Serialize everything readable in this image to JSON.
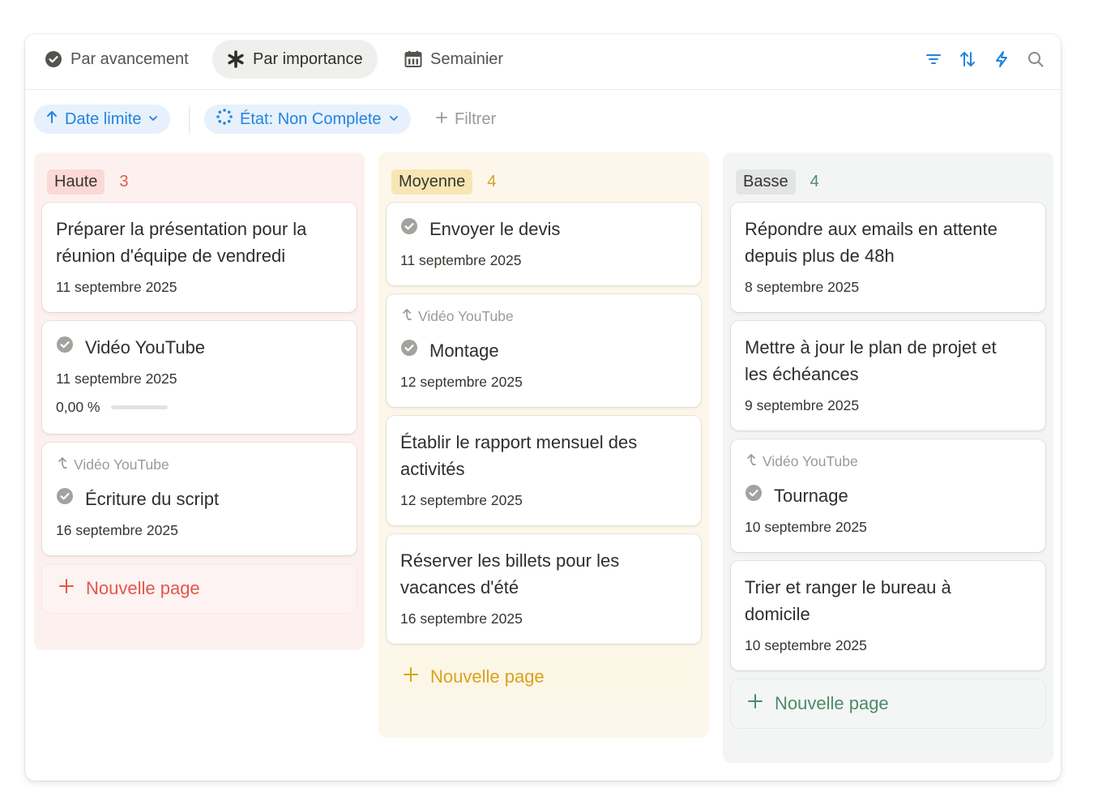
{
  "tabs": [
    {
      "label": "Par avancement",
      "icon": "check-circle-icon",
      "active": false
    },
    {
      "label": "Par importance",
      "icon": "asterisk-icon",
      "active": true
    },
    {
      "label": "Semainier",
      "icon": "calendar-icon",
      "active": false
    }
  ],
  "toolbar_icons": [
    "filter-icon",
    "sort-icon",
    "lightning-icon",
    "search-icon"
  ],
  "filters": {
    "sort_chip": "Date limite",
    "status_chip": "État: Non Complete",
    "add_filter": "Filtrer"
  },
  "colors": {
    "accent": "#2383e2",
    "haute": "#e2574c",
    "moyenne": "#d9a21f",
    "basse": "#4d8a6a",
    "haute_pill": "#fbd9d6",
    "moyenne_pill": "#f8e6b4",
    "basse_pill": "#e3e5e4"
  },
  "columns": [
    {
      "name": "Haute",
      "count": "3",
      "new_page": "Nouvelle page",
      "cards": [
        {
          "title_line1": "Préparer la présentation pour la",
          "title_line2": "réunion d'équipe de vendredi",
          "date": "11 septembre 2025"
        },
        {
          "title": "Vidéo YouTube",
          "date": "11 septembre 2025",
          "progress": "0,00 %",
          "progress_value": 0
        },
        {
          "parent": "Vidéo YouTube",
          "title": "Écriture du script",
          "date": "16 septembre 2025"
        }
      ]
    },
    {
      "name": "Moyenne",
      "count": "4",
      "new_page": "Nouvelle page",
      "cards": [
        {
          "title": "Envoyer le devis",
          "date": "11 septembre 2025"
        },
        {
          "parent": "Vidéo YouTube",
          "title": "Montage",
          "date": "12 septembre 2025"
        },
        {
          "title_line1": "Établir le rapport mensuel des",
          "title_line2": "activités",
          "date": "12 septembre 2025"
        },
        {
          "title_line1": "Réserver les billets pour les",
          "title_line2": "vacances d'été",
          "date": "16 septembre 2025"
        }
      ]
    },
    {
      "name": "Basse",
      "count": "4",
      "new_page": "Nouvelle page",
      "cards": [
        {
          "title_line1": "Répondre aux emails en attente",
          "title_line2": "depuis plus de 48h",
          "date": "8 septembre 2025"
        },
        {
          "title_line1": "Mettre à jour le plan de projet et",
          "title_line2": "les échéances",
          "date": "9 septembre 2025"
        },
        {
          "parent": "Vidéo YouTube",
          "title": "Tournage",
          "date": "10 septembre 2025"
        },
        {
          "title_line1": "Trier et ranger le bureau à",
          "title_line2": "domicile",
          "date": "10 septembre 2025"
        }
      ]
    }
  ]
}
